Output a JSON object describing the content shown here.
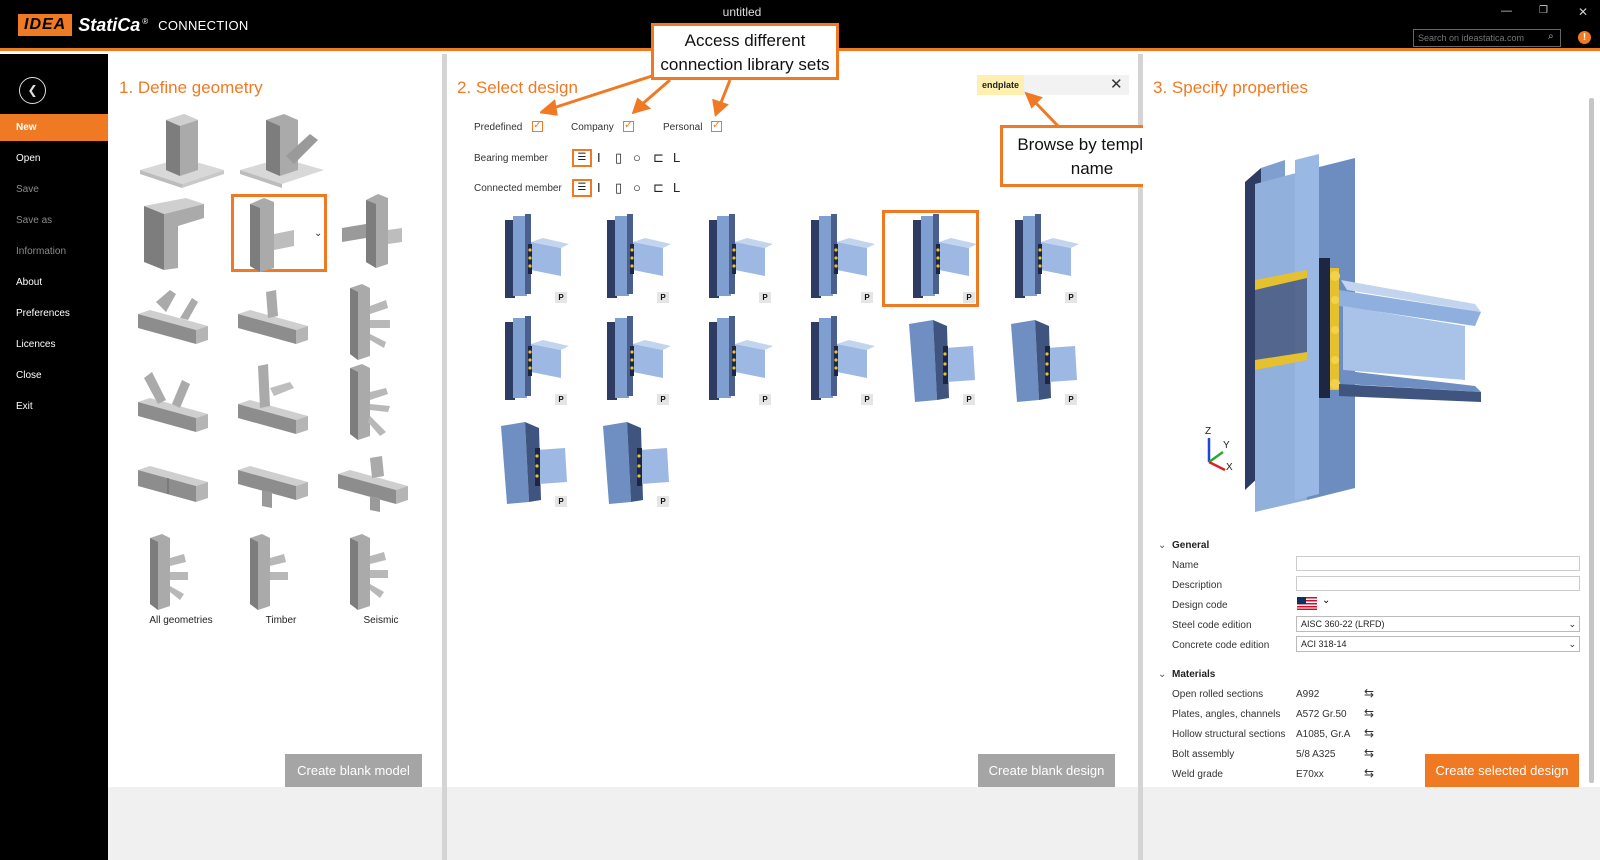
{
  "window": {
    "title": "untitled",
    "logo_text": "IDEA",
    "brand": "StatiCa",
    "brand_mark": "®",
    "product": "CONNECTION",
    "search_placeholder": "Search on ideastatica.com"
  },
  "colors": {
    "accent": "#f07a23",
    "sidebar_bg": "#000000",
    "steel_blue": "#7f9fd0",
    "geometry_gray": "#9a9a9a"
  },
  "sidebar": {
    "items": [
      {
        "label": "New",
        "state": "active"
      },
      {
        "label": "Open",
        "state": "enabled"
      },
      {
        "label": "Save",
        "state": "disabled"
      },
      {
        "label": "Save as",
        "state": "disabled"
      },
      {
        "label": "Information",
        "state": "disabled"
      },
      {
        "label": "About",
        "state": "enabled"
      },
      {
        "label": "Preferences",
        "state": "enabled"
      },
      {
        "label": "Licences",
        "state": "enabled"
      },
      {
        "label": "Close",
        "state": "enabled"
      },
      {
        "label": "Exit",
        "state": "enabled"
      }
    ]
  },
  "geometry": {
    "title": "1. Define geometry",
    "labels": {
      "all": "All geometries",
      "timber": "Timber",
      "seismic": "Seismic"
    },
    "button": "Create blank model"
  },
  "design": {
    "title": "2. Select design",
    "libraries": {
      "predefined": "Predefined",
      "company": "Company",
      "personal": "Personal"
    },
    "filters": {
      "bearing": "Bearing member",
      "connected": "Connected member"
    },
    "search_value": "endplate",
    "badge": "P",
    "button": "Create blank design"
  },
  "properties": {
    "title": "3. Specify properties",
    "general": {
      "heading": "General",
      "name_label": "Name",
      "description_label": "Description",
      "design_code_label": "Design code",
      "steel_label": "Steel code edition",
      "steel_value": "AISC 360-22 (LRFD)",
      "concrete_label": "Concrete code edition",
      "concrete_value": "ACI 318-14"
    },
    "materials": {
      "heading": "Materials",
      "rows": [
        {
          "label": "Open rolled sections",
          "value": "A992"
        },
        {
          "label": "Plates, angles, channels",
          "value": "A572 Gr.50"
        },
        {
          "label": "Hollow structural sections",
          "value": "A1085, Gr.A"
        },
        {
          "label": "Bolt assembly",
          "value": "5/8 A325"
        },
        {
          "label": "Weld grade",
          "value": "E70xx"
        }
      ]
    },
    "axes": {
      "z": "Z",
      "y": "Y",
      "x": "X"
    },
    "button": "Create selected design"
  },
  "callouts": {
    "libraries": "Access different connection library sets",
    "search": "Browse by template name"
  }
}
